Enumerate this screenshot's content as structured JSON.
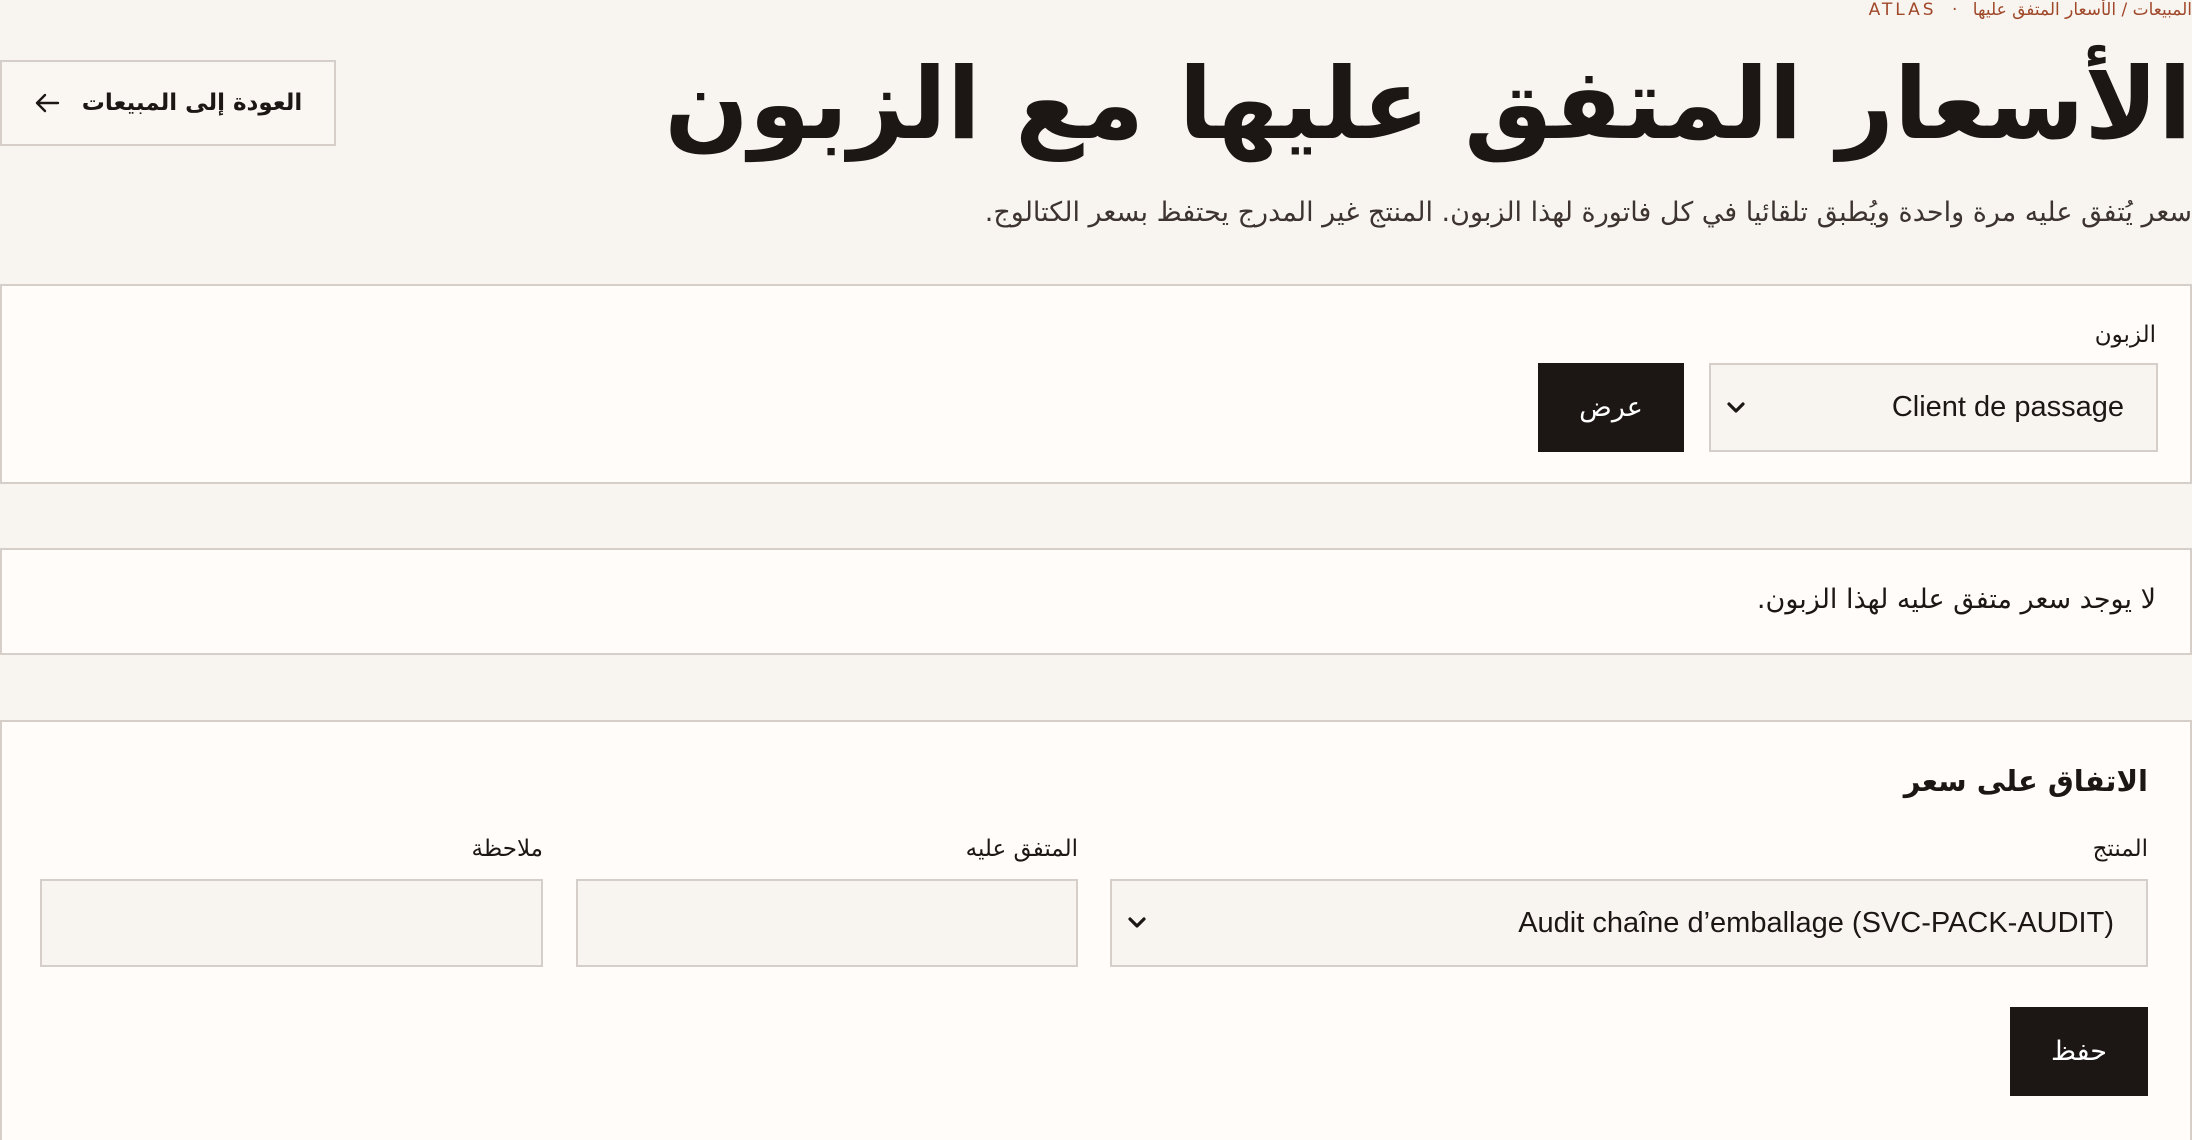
{
  "breadcrumb": {
    "brand": "ATLAS",
    "separator": "·",
    "path": "المبيعات / الأسعار المتفق عليها"
  },
  "page": {
    "title": "الأسعار المتفق عليها مع الزبون",
    "subtitle": "سعر يُتفق عليه مرة واحدة ويُطبق تلقائيا في كل فاتورة لهذا الزبون. المنتج غير المدرج يحتفظ بسعر الكتالوج."
  },
  "back_button": {
    "label": "العودة إلى المبيعات",
    "icon": "arrow-left-icon"
  },
  "customer_filter": {
    "label": "الزبون",
    "selected": "Client de passage",
    "show_label": "عرض"
  },
  "empty_state": {
    "message": "لا يوجد سعر متفق عليه لهذا الزبون."
  },
  "agree_form": {
    "title": "الاتفاق على سعر",
    "product_label": "المنتج",
    "product_selected": "Audit chaîne d’emballage (SVC-PACK-AUDIT)",
    "price_label": "المتفق عليه",
    "price_value": "",
    "note_label": "ملاحظة",
    "note_value": "",
    "save_label": "حفظ"
  },
  "colors": {
    "accent": "#a0482a",
    "dark": "#1c1614",
    "background": "#f8f5f0",
    "card": "#fffcfa",
    "border": "#d6cec8"
  }
}
